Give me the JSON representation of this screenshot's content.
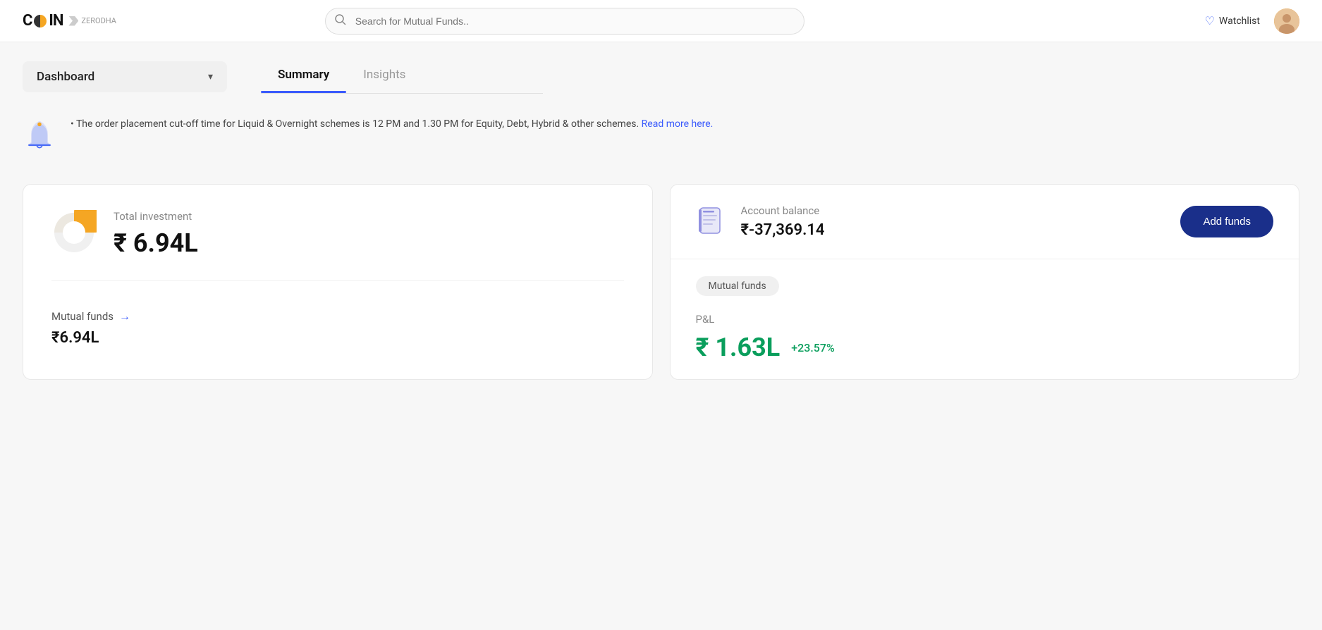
{
  "header": {
    "logo_text_c": "C",
    "logo_text_oin": "OIN",
    "logo_zerodha": "ZERODHA",
    "search_placeholder": "Search for Mutual Funds..",
    "watchlist_label": "Watchlist",
    "search_icon": "search-icon",
    "heart_icon": "heart-icon",
    "avatar_icon": "avatar-icon"
  },
  "nav": {
    "dashboard_label": "Dashboard",
    "dropdown_icon": "chevron-down-icon",
    "tabs": [
      {
        "id": "summary",
        "label": "Summary",
        "active": true
      },
      {
        "id": "insights",
        "label": "Insights",
        "active": false
      }
    ]
  },
  "notification": {
    "bell_icon": "bell-icon",
    "message": "The order placement cut-off time for Liquid & Overnight schemes is 12 PM and 1.30 PM for Equity, Debt, Hybrid & other schemes.",
    "link_text": "Read more here.",
    "link_url": "#"
  },
  "left_card": {
    "total_investment_label": "Total investment",
    "total_investment_value": "₹ 6.94L",
    "pie_icon": "pie-chart-icon",
    "mutual_funds_label": "Mutual funds",
    "mutual_funds_arrow": "→",
    "mutual_funds_value": "₹6.94L"
  },
  "right_card": {
    "account_icon": "book-icon",
    "account_balance_label": "Account balance",
    "account_balance_value": "₹-37,369.14",
    "add_funds_label": "Add funds",
    "mutual_funds_badge": "Mutual funds",
    "pnl_label": "P&L",
    "pnl_value": "₹ 1.63L",
    "pnl_percent": "+23.57%"
  },
  "colors": {
    "accent_blue": "#3b5bfc",
    "dark_navy": "#1a2f8a",
    "green": "#0a9e5c",
    "pie_yellow": "#f5a623",
    "pie_orange": "#e05a00",
    "bell_blue": "#4a6cf7",
    "account_purple": "#7b7bef"
  }
}
